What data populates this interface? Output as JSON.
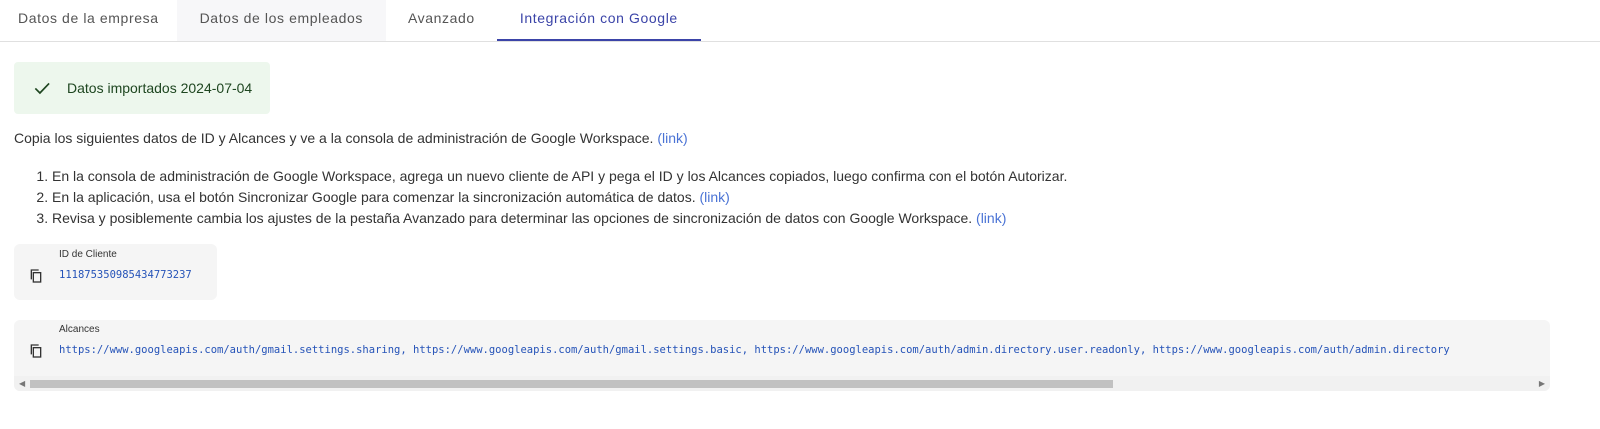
{
  "tabs": [
    {
      "label": "Datos de la empresa"
    },
    {
      "label": "Datos de los empleados"
    },
    {
      "label": "Avanzado"
    },
    {
      "label": "Integración con Google"
    }
  ],
  "active_tab": "Integración con Google",
  "alert": {
    "icon": "check-icon",
    "text": "Datos importados 2024-07-04",
    "background": "#edf7ed"
  },
  "intro": {
    "text": "Copia los siguientes datos de ID y Alcances y ve a la consola de administración de Google Workspace.",
    "link": "(link)"
  },
  "steps": [
    {
      "text": "En la consola de administración de Google Workspace, agrega un nuevo cliente de API y pega el ID y los Alcances copiados, luego confirma con el botón Autorizar.",
      "link": ""
    },
    {
      "text": "En la aplicación, usa el botón Sincronizar Google para comenzar la sincronización automática de datos.",
      "link": "(link)"
    },
    {
      "text": "Revisa y posiblemente cambia los ajustes de la pestaña Avanzado para determinar las opciones de sincronización de datos con Google Workspace.",
      "link": "(link)"
    }
  ],
  "client_id": {
    "label": "ID de Cliente",
    "value": "111875350985434773237",
    "icon": "copy-icon"
  },
  "scopes": {
    "label": "Alcances",
    "value": "https://www.googleapis.com/auth/gmail.settings.sharing, https://www.googleapis.com/auth/gmail.settings.basic, https://www.googleapis.com/auth/admin.directory.user.readonly, https://www.googleapis.com/auth/admin.directory",
    "icon": "copy-icon",
    "scroll_position": 0.72
  },
  "colors": {
    "accent": "#3b44a8",
    "link": "#4a73d5",
    "mono_value": "#2553b8"
  }
}
